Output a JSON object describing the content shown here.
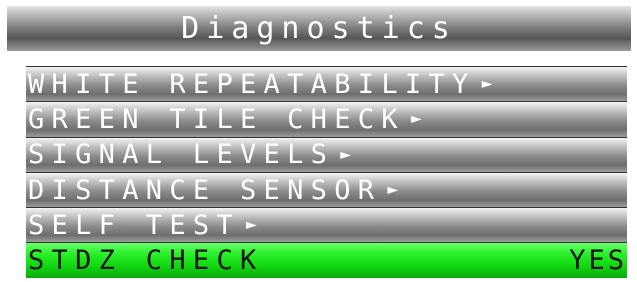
{
  "window": {
    "title": "Diagnostics"
  },
  "menu": {
    "items": [
      {
        "label": "WHITE REPEATABILITY",
        "arrow": "►"
      },
      {
        "label": "GREEN TILE CHECK",
        "arrow": "►"
      },
      {
        "label": "SIGNAL LEVELS",
        "arrow": "►"
      },
      {
        "label": "DISTANCE SENSOR",
        "arrow": "►"
      },
      {
        "label": "SELF TEST",
        "arrow": "►"
      }
    ],
    "selected": {
      "label": "STDZ CHECK",
      "value": "YES"
    }
  },
  "colors": {
    "selected_bg": "#1ee01e",
    "item_text": "#ffffff",
    "selected_text": "#111111"
  },
  "icons": {
    "submenu": "triangle-right-icon"
  }
}
